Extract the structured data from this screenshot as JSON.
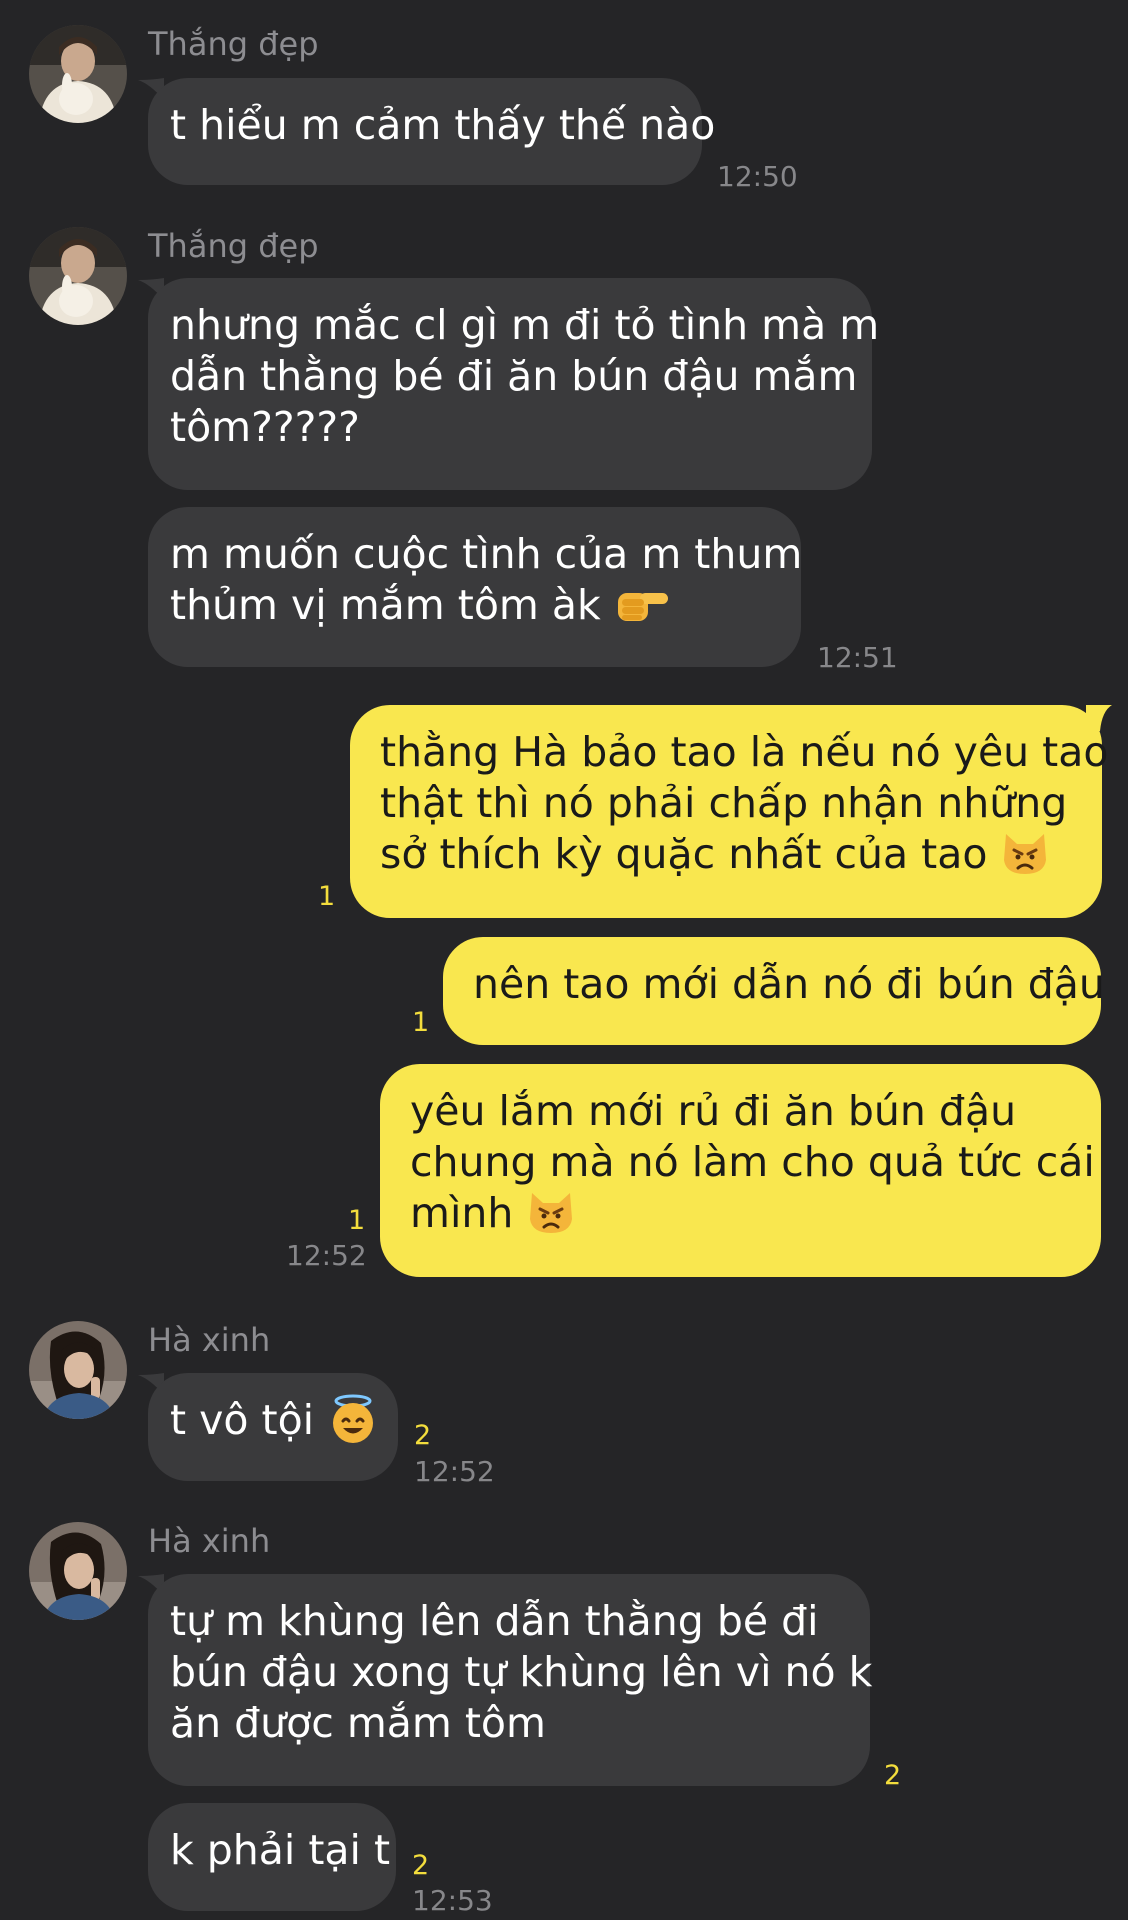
{
  "colors": {
    "background": "#252527",
    "incoming_bubble": "#3a3a3c",
    "outgoing_bubble": "#f9e74f",
    "sender_name": "#8d8d91",
    "timestamp": "#87878a",
    "unread_count": "#f3dd3d"
  },
  "messages": [
    {
      "sender": "Thắng đẹp",
      "lines": [
        "t hiểu m cảm thấy thế nào"
      ],
      "time": "12:50"
    },
    {
      "sender": "Thắng đẹp",
      "lines": [
        "nhưng mắc cl gì m đi tỏ tình mà m",
        "dẫn thằng bé đi ăn bún đậu mắm",
        "tôm?????"
      ]
    },
    {
      "lines": [
        "m muốn cuộc tình của m thum",
        "thủm vị mắm tôm àk"
      ],
      "emoji": "backhand-index-pointing-right-icon",
      "time": "12:51"
    },
    {
      "lines": [
        "thằng Hà bảo tao là nếu nó yêu tao",
        "thật thì nó phải chấp nhận những",
        "sở thích kỳ quặc nhất của tao"
      ],
      "emoji": "pouting-cat-icon",
      "unread": "1"
    },
    {
      "lines": [
        "nên tao mới dẫn nó đi bún đậu"
      ],
      "unread": "1"
    },
    {
      "lines": [
        "yêu lắm mới rủ đi ăn bún đậu",
        "chung mà nó làm cho quả tức cái",
        "mình"
      ],
      "emoji": "pouting-cat-icon",
      "unread": "1",
      "time": "12:52"
    },
    {
      "sender": "Hà xinh",
      "lines": [
        "t vô tội"
      ],
      "emoji": "smiling-face-with-halo-icon",
      "unread": "2",
      "time": "12:52"
    },
    {
      "sender": "Hà xinh",
      "lines": [
        "tự m khùng lên dẫn thằng bé đi",
        "bún đậu xong tự khùng lên vì nó k",
        "ăn được mắm tôm"
      ],
      "unread": "2"
    },
    {
      "lines": [
        "k phải tại t"
      ],
      "unread": "2",
      "time": "12:53"
    }
  ]
}
